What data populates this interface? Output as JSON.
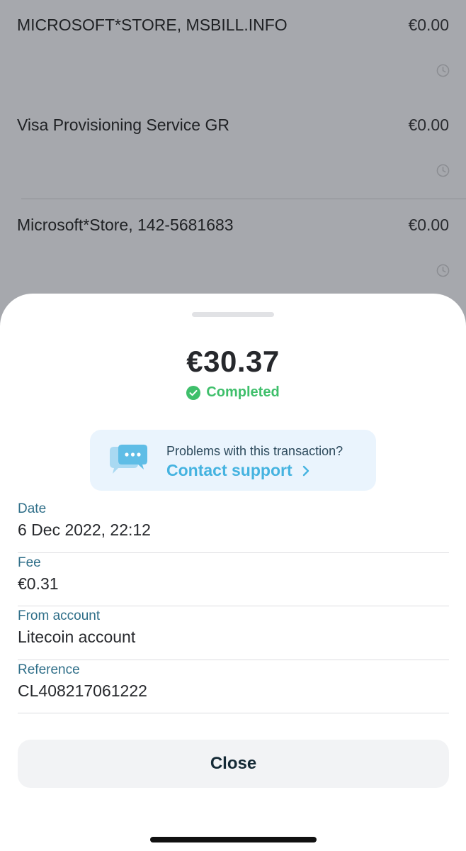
{
  "background_transactions": [
    {
      "name": "MICROSOFT*STORE, MSBILL.INFO",
      "amount": "€0.00",
      "icon": "clock-icon"
    },
    {
      "name": "Visa Provisioning Service GR",
      "amount": "€0.00",
      "icon": "clock-icon"
    },
    {
      "name": "Microsoft*Store, 142-5681683",
      "amount": "€0.00",
      "icon": "clock-icon"
    }
  ],
  "sheet": {
    "amount": "€30.37",
    "status": "Completed",
    "status_color": "#3fbf6b",
    "support": {
      "question": "Problems with this transaction?",
      "link": "Contact support",
      "icon": "chat-bubble-icon",
      "link_color": "#45b3e0"
    },
    "fields": [
      {
        "label": "Date",
        "value": "6 Dec 2022, 22:12"
      },
      {
        "label": "Fee",
        "value": "€0.31"
      },
      {
        "label": "From account",
        "value": "Litecoin account"
      },
      {
        "label": "Reference",
        "value": "CL408217061222"
      }
    ],
    "close_label": "Close"
  }
}
